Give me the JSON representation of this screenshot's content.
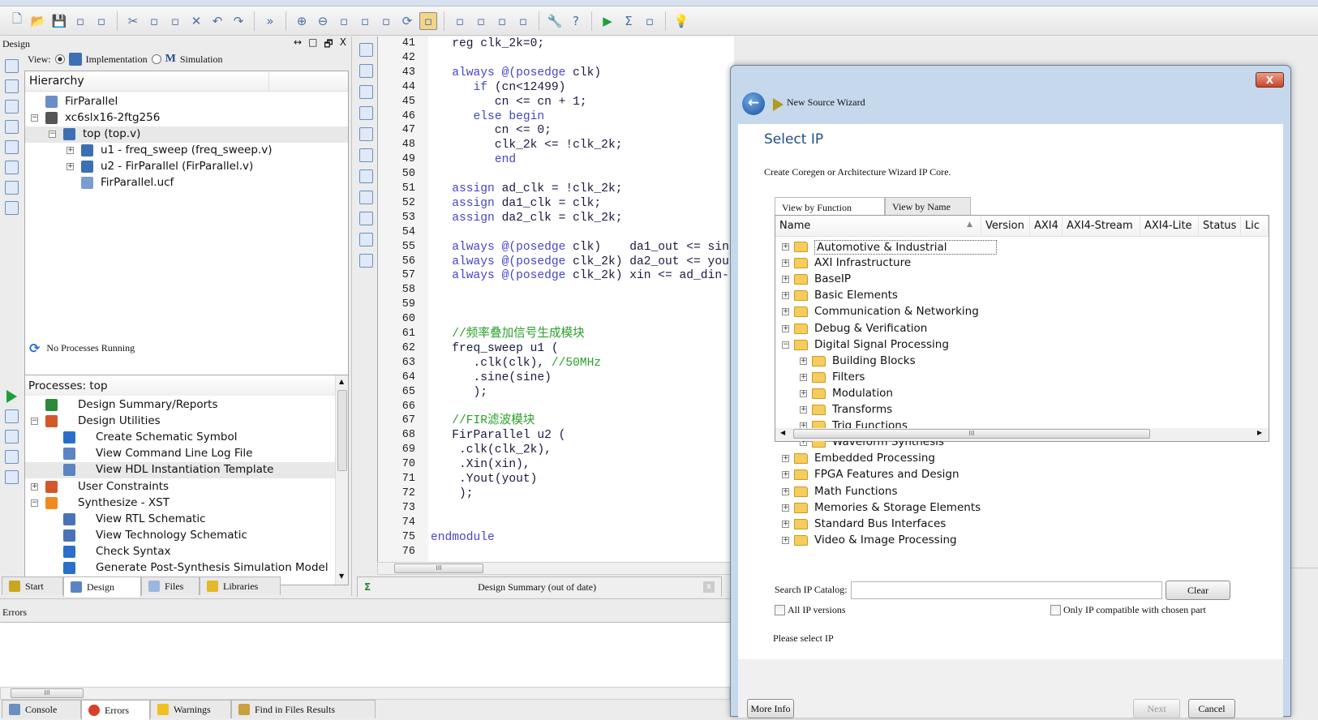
{
  "toolbar": {
    "icons": [
      "new-file-icon",
      "open-folder-icon",
      "save-icon",
      "save-all-icon",
      "print-icon",
      "|",
      "cut-icon",
      "copy-icon",
      "paste-icon",
      "delete-icon",
      "undo-icon",
      "redo-icon",
      "|",
      "more-icon",
      "|",
      "zoom-in-icon",
      "zoom-out-icon",
      "zoom-fit-icon",
      "zoom-full-icon",
      "zoom-select-icon",
      "refresh-icon",
      "design-tool-icon",
      "|",
      "cascade-icon",
      "tile-horizontal-icon",
      "tile-vertical-icon",
      "float-icon",
      "|",
      "properties-icon",
      "help-icon",
      "|",
      "run-icon",
      "summary-icon",
      "probe-icon",
      "|",
      "tip-icon"
    ]
  },
  "design_panel": {
    "title": "Design",
    "controls": [
      "↔",
      "□",
      "🗗",
      "X"
    ],
    "view_label": "View:",
    "view_options": [
      "Implementation",
      "Simulation"
    ],
    "view_selected": "Implementation",
    "hierarchy_header": "Hierarchy",
    "hierarchy": [
      {
        "label": "FirParallel",
        "level": 0,
        "exp": "",
        "icon": "project"
      },
      {
        "label": "xc6slx16-2ftg256",
        "level": 0,
        "exp": "-",
        "icon": "chip"
      },
      {
        "label": "top (top.v)",
        "level": 1,
        "exp": "-",
        "icon": "verilog-top",
        "selected": true
      },
      {
        "label": "u1 - freq_sweep (freq_sweep.v)",
        "level": 2,
        "exp": "+",
        "icon": "verilog"
      },
      {
        "label": "u2 - FirParallel (FirParallel.v)",
        "level": 2,
        "exp": "+",
        "icon": "verilog"
      },
      {
        "label": "FirParallel.ucf",
        "level": 2,
        "exp": "",
        "icon": "ucf"
      }
    ],
    "process_status": "No Processes Running",
    "processes_header": "Processes: top",
    "processes": [
      {
        "label": "Design Summary/Reports",
        "level": 0,
        "exp": "",
        "icon": "sigma"
      },
      {
        "label": "Design Utilities",
        "level": 0,
        "exp": "-",
        "icon": "tools"
      },
      {
        "label": "Create Schematic Symbol",
        "level": 1,
        "exp": "",
        "icon": "run"
      },
      {
        "label": "View Command Line Log File",
        "level": 1,
        "exp": "",
        "icon": "doc"
      },
      {
        "label": "View HDL Instantiation Template",
        "level": 1,
        "exp": "",
        "icon": "doc",
        "selected": true
      },
      {
        "label": "User Constraints",
        "level": 0,
        "exp": "+",
        "icon": "tools"
      },
      {
        "label": "Synthesize - XST",
        "level": 0,
        "exp": "-",
        "icon": "run-question"
      },
      {
        "label": "View RTL Schematic",
        "level": 1,
        "exp": "",
        "icon": "schematic"
      },
      {
        "label": "View Technology Schematic",
        "level": 1,
        "exp": "",
        "icon": "schematic"
      },
      {
        "label": "Check Syntax",
        "level": 1,
        "exp": "",
        "icon": "run"
      },
      {
        "label": "Generate Post-Synthesis Simulation Model",
        "level": 1,
        "exp": "",
        "icon": "run"
      }
    ],
    "tabs": [
      "Start",
      "Design",
      "Files",
      "Libraries"
    ],
    "active_tab": "Design"
  },
  "editor": {
    "lines": [
      {
        "n": 41,
        "seg": [
          [
            "tx",
            "   reg clk_2k=0;"
          ]
        ]
      },
      {
        "n": 42,
        "seg": []
      },
      {
        "n": 43,
        "seg": [
          [
            "kw",
            "   always @(posedge"
          ],
          [
            "tx",
            " clk)"
          ]
        ]
      },
      {
        "n": 44,
        "seg": [
          [
            "kw",
            "      if"
          ],
          [
            "tx",
            " (cn<12499)"
          ]
        ]
      },
      {
        "n": 45,
        "seg": [
          [
            "tx",
            "         cn <= cn + 1;"
          ]
        ]
      },
      {
        "n": 46,
        "seg": [
          [
            "kw",
            "      else begin"
          ]
        ]
      },
      {
        "n": 47,
        "seg": [
          [
            "tx",
            "         cn <= 0;"
          ]
        ]
      },
      {
        "n": 48,
        "seg": [
          [
            "tx",
            "         clk_2k <= !clk_2k;"
          ]
        ]
      },
      {
        "n": 49,
        "seg": [
          [
            "kw",
            "         end"
          ]
        ]
      },
      {
        "n": 50,
        "seg": []
      },
      {
        "n": 51,
        "seg": [
          [
            "kw",
            "   assign"
          ],
          [
            "tx",
            " ad_clk = !clk_2k;"
          ]
        ]
      },
      {
        "n": 52,
        "seg": [
          [
            "kw",
            "   assign"
          ],
          [
            "tx",
            " da1_clk = clk;"
          ]
        ]
      },
      {
        "n": 53,
        "seg": [
          [
            "kw",
            "   assign"
          ],
          [
            "tx",
            " da2_clk = clk_2k;"
          ]
        ]
      },
      {
        "n": 54,
        "seg": []
      },
      {
        "n": 55,
        "seg": [
          [
            "kw",
            "   always @(posedge"
          ],
          [
            "tx",
            " clk)    da1_out <= sin"
          ]
        ]
      },
      {
        "n": 56,
        "seg": [
          [
            "kw",
            "   always @(posedge"
          ],
          [
            "tx",
            " clk_2k) da2_out <= you"
          ]
        ]
      },
      {
        "n": 57,
        "seg": [
          [
            "kw",
            "   always @(posedge"
          ],
          [
            "tx",
            " clk_2k) xin <= ad_din-"
          ]
        ]
      },
      {
        "n": 58,
        "seg": []
      },
      {
        "n": 59,
        "seg": []
      },
      {
        "n": 60,
        "seg": []
      },
      {
        "n": 61,
        "seg": [
          [
            "cm",
            "   //频率叠加信号生成模块"
          ]
        ]
      },
      {
        "n": 62,
        "seg": [
          [
            "tx",
            "   freq_sweep u1 ("
          ]
        ]
      },
      {
        "n": 63,
        "seg": [
          [
            "tx",
            "      .clk(clk), "
          ],
          [
            "cm",
            "//50MHz"
          ]
        ]
      },
      {
        "n": 64,
        "seg": [
          [
            "tx",
            "      .sine(sine)"
          ]
        ]
      },
      {
        "n": 65,
        "seg": [
          [
            "tx",
            "      );"
          ]
        ]
      },
      {
        "n": 66,
        "seg": []
      },
      {
        "n": 67,
        "seg": [
          [
            "cm",
            "   //FIR滤波模块"
          ]
        ]
      },
      {
        "n": 68,
        "seg": [
          [
            "tx",
            "   FirParallel u2 ("
          ]
        ]
      },
      {
        "n": 69,
        "seg": [
          [
            "tx",
            "    .clk(clk_2k),"
          ]
        ]
      },
      {
        "n": 70,
        "seg": [
          [
            "tx",
            "    .Xin(xin),"
          ]
        ]
      },
      {
        "n": 71,
        "seg": [
          [
            "tx",
            "    .Yout(yout)"
          ]
        ]
      },
      {
        "n": 72,
        "seg": [
          [
            "tx",
            "    );"
          ]
        ]
      },
      {
        "n": 73,
        "seg": []
      },
      {
        "n": 74,
        "seg": []
      },
      {
        "n": 75,
        "seg": [
          [
            "kw",
            "endmodule"
          ]
        ]
      },
      {
        "n": 76,
        "seg": []
      }
    ],
    "doc_tab": "Design Summary (out of date)"
  },
  "console": {
    "title": "Errors",
    "tabs": [
      "Console",
      "Errors",
      "Warnings",
      "Find in Files Results"
    ],
    "active_tab": "Errors"
  },
  "wizard": {
    "window_title": "New Source Wizard",
    "heading": "Select IP",
    "description": "Create Coregen or Architecture Wizard IP Core.",
    "tabs": [
      "View by Function",
      "View by Name"
    ],
    "active_tab": "View by Function",
    "columns": [
      "Name",
      "Version",
      "AXI4",
      "AXI4-Stream",
      "AXI4-Lite",
      "Status",
      "Lic"
    ],
    "categories": [
      {
        "label": "Automotive & Industrial",
        "level": 0,
        "exp": "+",
        "focused": true
      },
      {
        "label": "AXI Infrastructure",
        "level": 0,
        "exp": "+"
      },
      {
        "label": "BaseIP",
        "level": 0,
        "exp": "+"
      },
      {
        "label": "Basic Elements",
        "level": 0,
        "exp": "+"
      },
      {
        "label": "Communication & Networking",
        "level": 0,
        "exp": "+"
      },
      {
        "label": "Debug & Verification",
        "level": 0,
        "exp": "+"
      },
      {
        "label": "Digital Signal Processing",
        "level": 0,
        "exp": "-"
      },
      {
        "label": "Building Blocks",
        "level": 1,
        "exp": "+"
      },
      {
        "label": "Filters",
        "level": 1,
        "exp": "+"
      },
      {
        "label": "Modulation",
        "level": 1,
        "exp": "+"
      },
      {
        "label": "Transforms",
        "level": 1,
        "exp": "+"
      },
      {
        "label": "Trig Functions",
        "level": 1,
        "exp": "+"
      },
      {
        "label": "Waveform Synthesis",
        "level": 1,
        "exp": "+"
      },
      {
        "label": "Embedded Processing",
        "level": 0,
        "exp": "+"
      },
      {
        "label": "FPGA Features and Design",
        "level": 0,
        "exp": "+"
      },
      {
        "label": "Math Functions",
        "level": 0,
        "exp": "+"
      },
      {
        "label": "Memories & Storage Elements",
        "level": 0,
        "exp": "+"
      },
      {
        "label": "Standard Bus Interfaces",
        "level": 0,
        "exp": "+"
      },
      {
        "label": "Video & Image Processing",
        "level": 0,
        "exp": "+"
      }
    ],
    "search_label": "Search IP Catalog:",
    "search_value": "",
    "clear_label": "Clear",
    "all_versions_label": "All IP versions",
    "all_versions_checked": false,
    "compatible_label": "Only IP compatible with chosen part",
    "compatible_checked": false,
    "status": "Please select IP",
    "more_info_label": "More Info",
    "next_label": "Next",
    "cancel_label": "Cancel",
    "close_label": "X"
  },
  "colors": {
    "keyword": "#4646c8",
    "comment": "#2aa02a",
    "dialog_frame": "#c5d8ec",
    "heading": "#1f4e8c",
    "folder": "#f4cd5c"
  }
}
